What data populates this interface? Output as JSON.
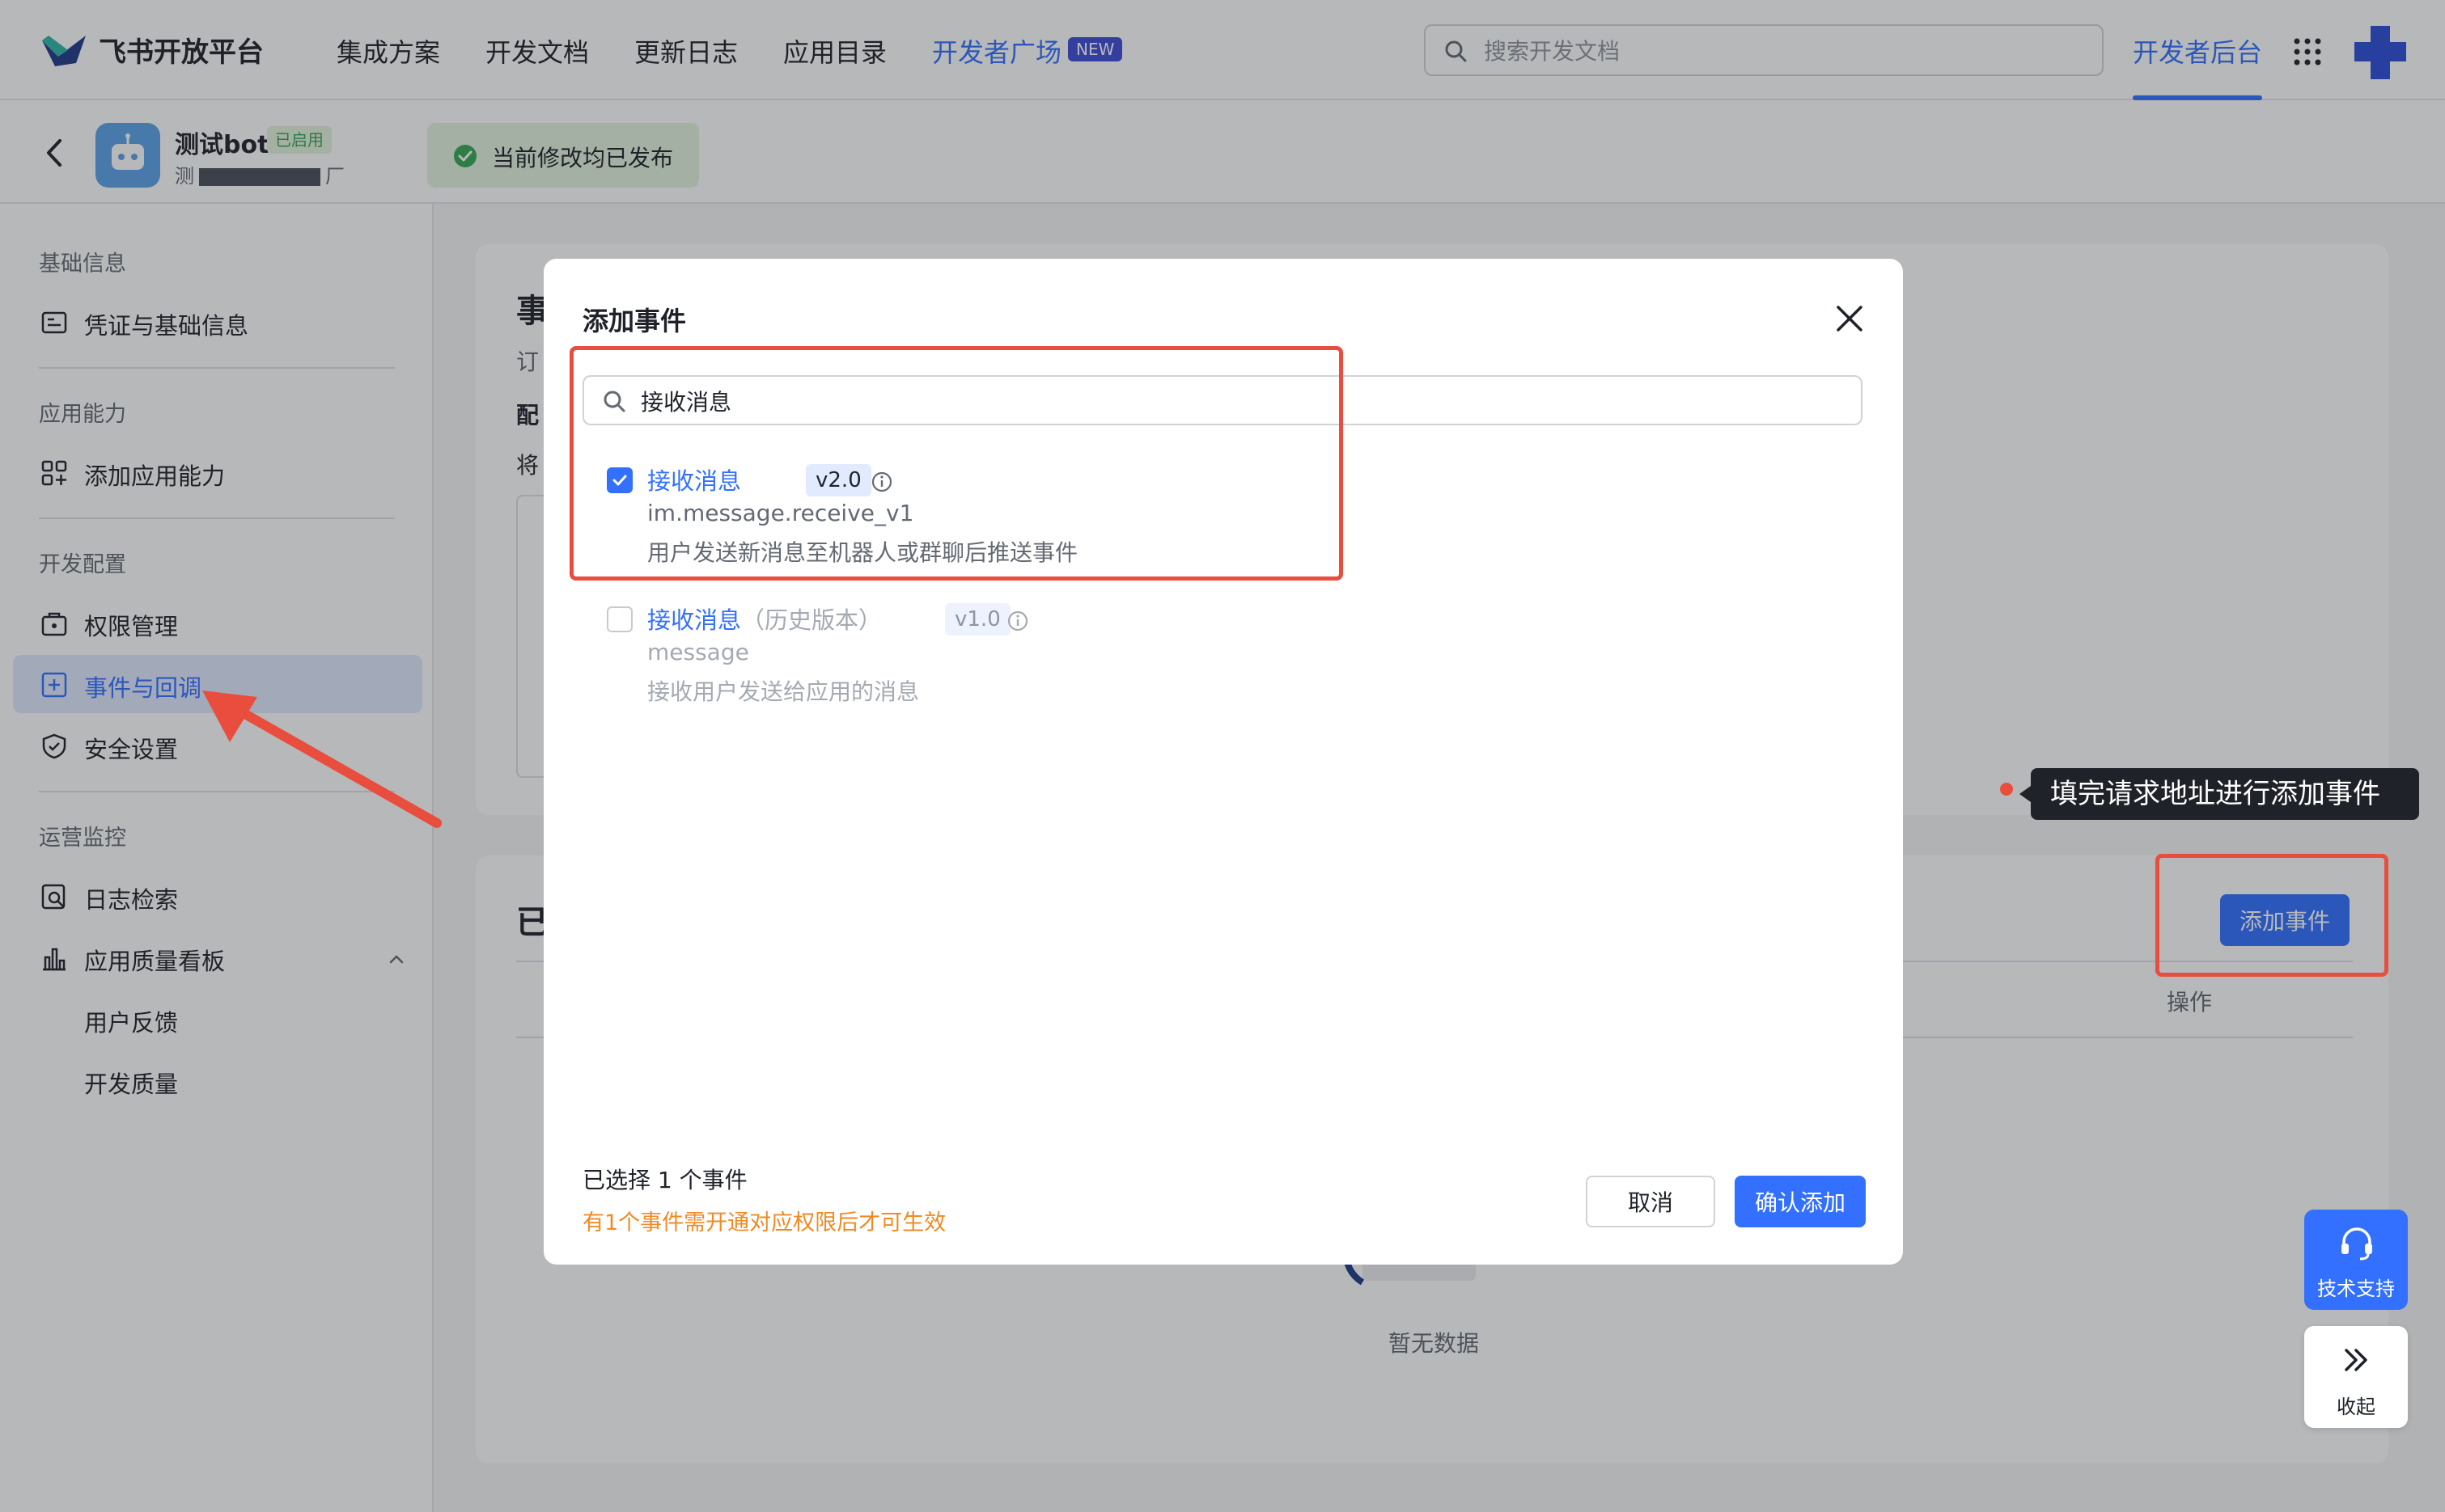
{
  "header": {
    "brand": "飞书开放平台",
    "nav": [
      "集成方案",
      "开发文档",
      "更新日志",
      "应用目录",
      "开发者广场"
    ],
    "new_badge": "NEW",
    "search_placeholder": "搜索开发文档",
    "dev_console": "开发者后台"
  },
  "app": {
    "name": "测试bot",
    "status": "已启用",
    "sub_prefix": "测",
    "sub_suffix": "厂",
    "published_status": "当前修改均已发布"
  },
  "sidebar": {
    "groups": [
      {
        "title": "基础信息",
        "items": [
          {
            "label": "凭证与基础信息",
            "icon": "credential-icon"
          }
        ]
      },
      {
        "title": "应用能力",
        "items": [
          {
            "label": "添加应用能力",
            "icon": "apps-icon"
          }
        ]
      },
      {
        "title": "开发配置",
        "items": [
          {
            "label": "权限管理",
            "icon": "lock-bag-icon"
          },
          {
            "label": "事件与回调",
            "icon": "plus-square-icon",
            "active": true
          },
          {
            "label": "安全设置",
            "icon": "shield-icon"
          }
        ]
      },
      {
        "title": "运营监控",
        "items": [
          {
            "label": "日志检索",
            "icon": "log-search-icon"
          },
          {
            "label": "应用质量看板",
            "icon": "bar-chart-icon"
          },
          {
            "label": "用户反馈"
          },
          {
            "label": "开发质量"
          }
        ]
      }
    ]
  },
  "main": {
    "card1_title_peek": "事",
    "card1_sub_peek": "订",
    "card1_line3_peek": "配",
    "card1_line4_peek": "将",
    "card2_title_peek": "已",
    "add_event_button": "添加事件",
    "column_operation": "操作",
    "empty_text": "暂无数据"
  },
  "annotation": {
    "tooltip": "填完请求地址进行添加事件",
    "colors": {
      "red": "#e84d3d"
    }
  },
  "modal": {
    "title": "添加事件",
    "search_value": "接收消息",
    "events": [
      {
        "name": "接收消息",
        "version": "v2.0",
        "code": "im.message.receive_v1",
        "description": "用户发送新消息至机器人或群聊后推送事件",
        "checked": true
      },
      {
        "name": "接收消息",
        "name_suffix": "（历史版本）",
        "version": "v1.0",
        "code": "message",
        "description": "接收用户发送给应用的消息",
        "checked": false,
        "disabled": true
      }
    ],
    "selected_count": "已选择 1 个事件",
    "warning": "有1个事件需开通对应权限后才可生效",
    "cancel": "取消",
    "confirm": "确认添加"
  },
  "floating": {
    "support": "技术支持",
    "collapse": "收起"
  },
  "colors": {
    "accent": "#3370ff",
    "warning": "#f08a24",
    "success": "#34a853"
  }
}
